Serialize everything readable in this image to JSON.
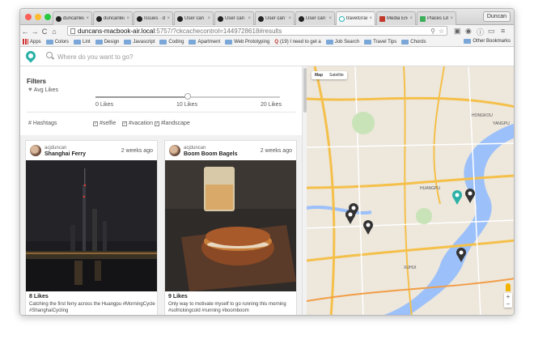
{
  "browser": {
    "tabs": [
      {
        "label": "duncanleung",
        "icon": "github-icon",
        "active": false
      },
      {
        "label": "duncanleung",
        "icon": "github-icon",
        "active": false
      },
      {
        "label": "Issues · dun",
        "icon": "github-icon",
        "active": false
      },
      {
        "label": "User can se",
        "icon": "github-icon",
        "active": false
      },
      {
        "label": "User can se",
        "icon": "github-icon",
        "active": false
      },
      {
        "label": "User can vie",
        "icon": "github-icon",
        "active": false
      },
      {
        "label": "User can vie",
        "icon": "github-icon",
        "active": false
      },
      {
        "label": "travelGram",
        "icon": "travelgram-icon",
        "active": true
      },
      {
        "label": "Media Endp",
        "icon": "instagram-icon",
        "active": false
      },
      {
        "label": "Places Libra",
        "icon": "maps-icon",
        "active": false
      }
    ],
    "tab_close": "×",
    "user_button": "Duncan",
    "url_host": "duncans-macbook-air.local",
    "url_path": ":5757/?ckcachecontrol=1449728618#results",
    "bookmarks": [
      {
        "label": "Apps",
        "icon": "apps-icon"
      },
      {
        "label": "Colors",
        "icon": "folder-icon"
      },
      {
        "label": "Lint",
        "icon": "folder-icon"
      },
      {
        "label": "Design",
        "icon": "folder-icon"
      },
      {
        "label": "Javascript",
        "icon": "folder-icon"
      },
      {
        "label": "Coding",
        "icon": "folder-icon"
      },
      {
        "label": "Apartment",
        "icon": "folder-icon"
      },
      {
        "label": "Web Prototyping",
        "icon": "folder-icon"
      },
      {
        "label": "(19) I need to get a",
        "icon": "quora-icon"
      },
      {
        "label": "Job Search",
        "icon": "folder-icon"
      },
      {
        "label": "Travel Tips",
        "icon": "folder-icon"
      },
      {
        "label": "Chords",
        "icon": "folder-icon"
      }
    ],
    "other_bookmarks": "Other Bookmarks"
  },
  "app": {
    "search_placeholder": "Where do you want to go?",
    "filters": {
      "title": "Filters",
      "avg_likes_label": "Avg Likes",
      "slider_min_label": "0 Likes",
      "slider_mid_label": "10 Likes",
      "slider_max_label": "20 Likes",
      "slider_value": 10,
      "slider_max": 20,
      "hashtags_label": "# Hashtags",
      "hashtags": [
        "#selfie",
        "#vacation",
        "#landscape"
      ]
    },
    "posts": [
      {
        "username": "acjduncan",
        "place": "Shanghai Ferry",
        "time_ago": "2 weeks ago",
        "likes": "8 Likes",
        "caption": "Catching the first ferry across the Huangpu #MorningCycle #ShanghaiCycling"
      },
      {
        "username": "acjduncan",
        "place": "Boom Boom Bagels",
        "time_ago": "2 weeks ago",
        "likes": "9 Likes",
        "caption": "Only way to motivate myself to go running this morning #sofrickingcold #running #boomboom"
      }
    ],
    "map": {
      "type_map": "Map",
      "type_satellite": "Satellite",
      "zoom_in": "+",
      "zoom_out": "−",
      "labels": [
        "HUANGPU",
        "HONGKOU",
        "XUHUI",
        "YANGPU"
      ]
    }
  },
  "colors": {
    "accent": "#2ab1a7",
    "map_water": "#9cc0f9",
    "map_road_major": "#f5c04a",
    "marker": "#333333"
  }
}
